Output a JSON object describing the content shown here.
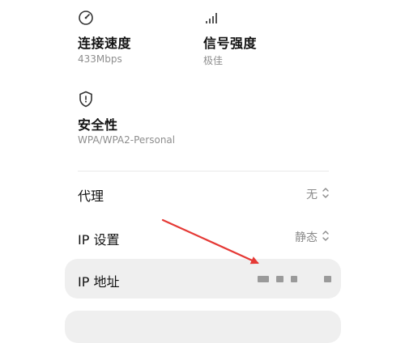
{
  "connection_speed": {
    "icon": "speedometer-icon",
    "label": "连接速度",
    "value": "433Mbps"
  },
  "signal_strength": {
    "icon": "signal-bars-icon",
    "label": "信号强度",
    "value": "极佳"
  },
  "security": {
    "icon": "shield-icon",
    "label": "安全性",
    "value": "WPA/WPA2-Personal"
  },
  "proxy": {
    "label": "代理",
    "value": "无"
  },
  "ip_settings": {
    "label": "IP 设置",
    "value": "静态"
  },
  "ip_address": {
    "label": "IP 地址",
    "value_redacted": true
  },
  "annotation": {
    "arrow_color": "#e53935"
  }
}
